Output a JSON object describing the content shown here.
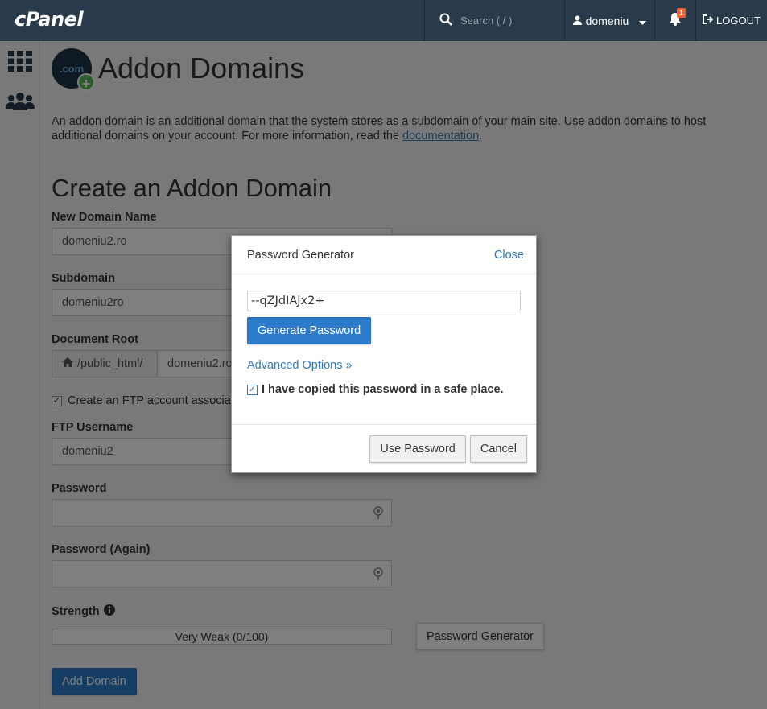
{
  "topbar": {
    "logo": "cPanel",
    "search_placeholder": "Search ( / )",
    "user": "domeniu",
    "notification_count": "1",
    "logout": "LOGOUT"
  },
  "page": {
    "title": "Addon Domains",
    "icon_text": ".com",
    "description_prefix": "An addon domain is an additional domain that the system stores as a subdomain of your main site. Use addon domains to host additional domains on your account. For more information, read the ",
    "doc_link": "documentation",
    "description_suffix": "."
  },
  "form": {
    "section_title": "Create an Addon Domain",
    "new_domain_label": "New Domain Name",
    "new_domain_value": "domeniu2.ro",
    "subdomain_label": "Subdomain",
    "subdomain_value": "domeniu2ro",
    "docroot_label": "Document Root",
    "docroot_prefix": "/public_html/",
    "docroot_value": "domeniu2.ro",
    "ftp_checkbox_label": "Create an FTP account associated with this Addon Domain.",
    "ftp_user_label": "FTP Username",
    "ftp_user_value": "domeniu2",
    "password_label": "Password",
    "password_again_label": "Password (Again)",
    "strength_label": "Strength",
    "strength_value": "Very Weak (0/100)",
    "password_generator_button": "Password Generator",
    "add_domain_button": "Add Domain"
  },
  "modal": {
    "title": "Password Generator",
    "close": "Close",
    "password_value": "--qZJdIAJx2+",
    "generate_button": "Generate Password",
    "advanced_options": "Advanced Options »",
    "copied_label": "I have copied this password in a safe place.",
    "use_button": "Use Password",
    "cancel_button": "Cancel"
  }
}
